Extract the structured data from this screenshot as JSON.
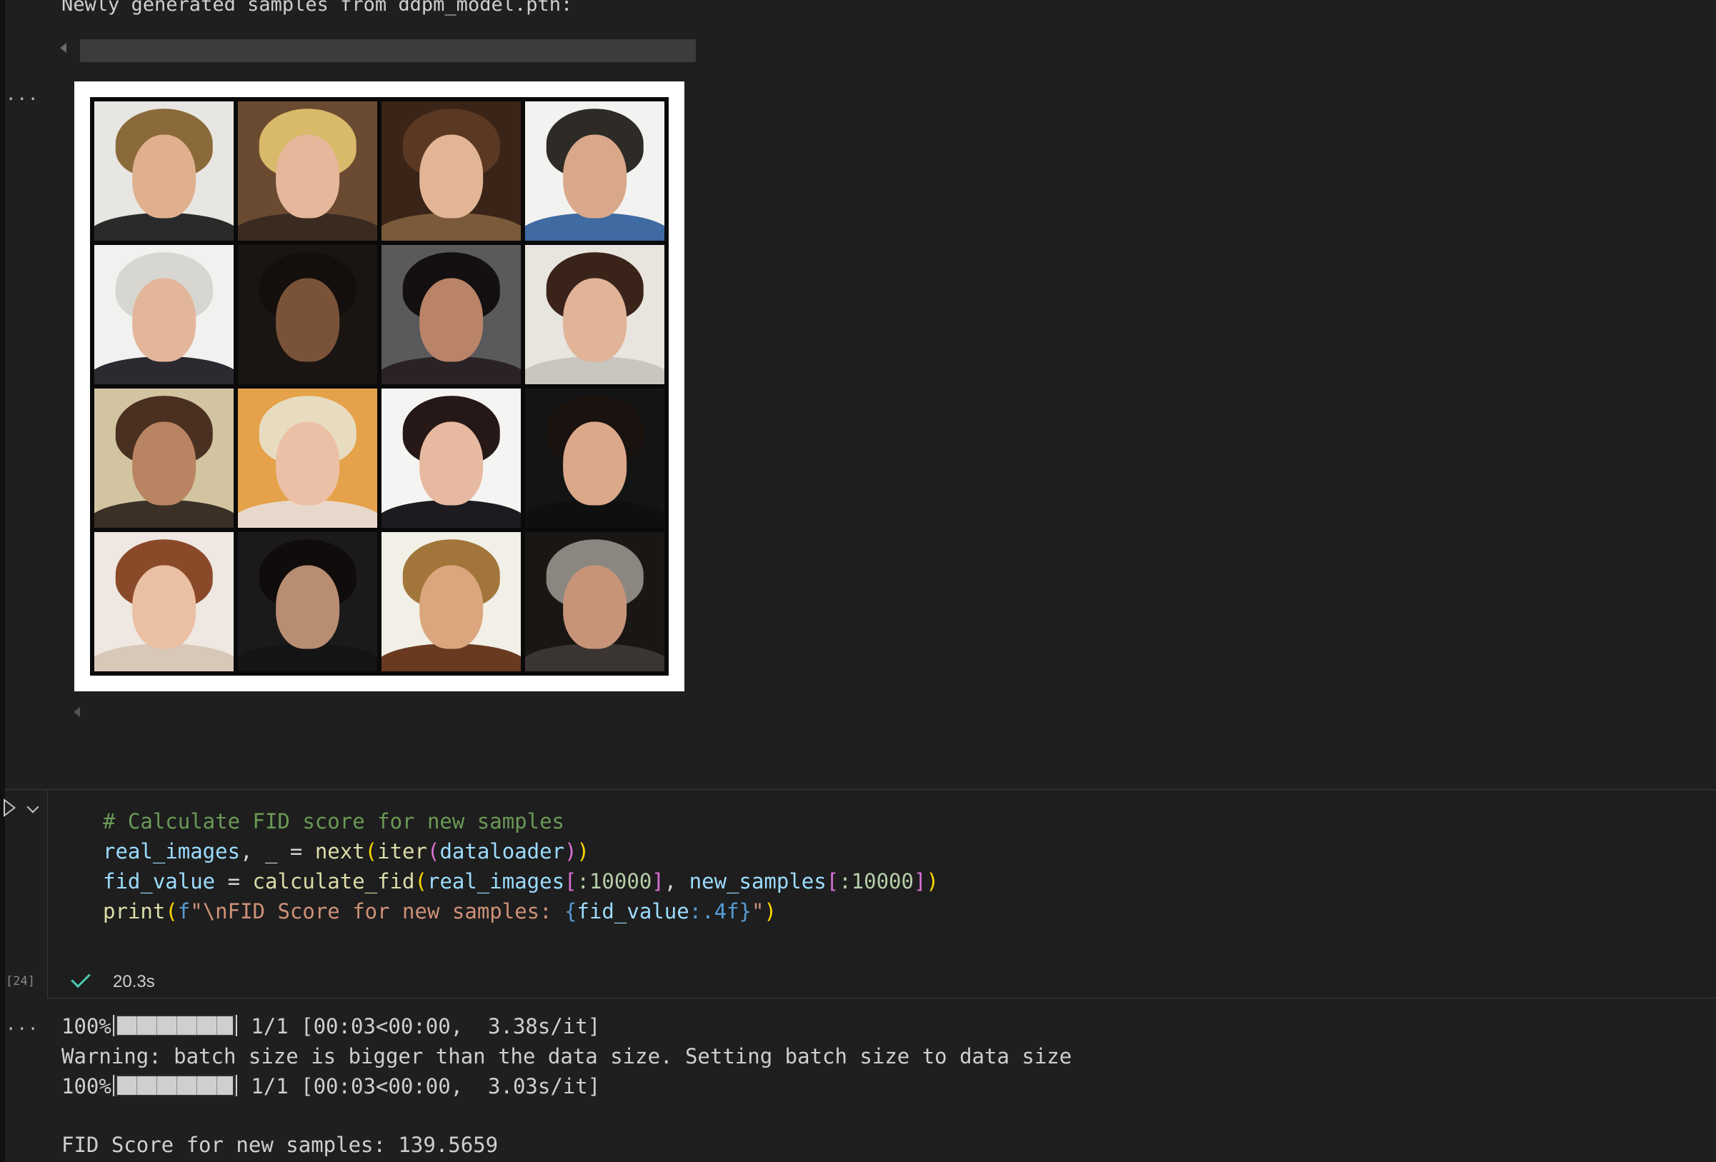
{
  "output_top": {
    "heading": "Newly generated samples from ddpm_model.pth:",
    "image_grid": {
      "rows": 4,
      "cols": 4,
      "tiles": [
        {
          "bg": "#e8e6e2",
          "hair": "#8a6a3a",
          "skin": "#e0b08e",
          "cloth": "#2a2a2a"
        },
        {
          "bg": "#6b4a32",
          "hair": "#d9b96a",
          "skin": "#e6b79a",
          "cloth": "#3a2a20"
        },
        {
          "bg": "#3a2418",
          "hair": "#5a3822",
          "skin": "#e2b594",
          "cloth": "#7a5a3a"
        },
        {
          "bg": "#f2f2f0",
          "hair": "#2e2a26",
          "skin": "#d9a88a",
          "cloth": "#3f6aa2"
        },
        {
          "bg": "#f1f1ef",
          "hair": "#d8d6d0",
          "skin": "#e3b69b",
          "cloth": "#2a2a30"
        },
        {
          "bg": "#1a1512",
          "hair": "#140f0c",
          "skin": "#7a5238",
          "cloth": "#1a1512"
        },
        {
          "bg": "#5a5a5c",
          "hair": "#141011",
          "skin": "#b98468",
          "cloth": "#2a2224"
        },
        {
          "bg": "#e8e4de",
          "hair": "#3a241a",
          "skin": "#e1b397",
          "cloth": "#c9c5bf"
        },
        {
          "bg": "#d2c4a0",
          "hair": "#4a3020",
          "skin": "#b98462",
          "cloth": "#3a3026"
        },
        {
          "bg": "#e5a24a",
          "hair": "#e8dcc0",
          "skin": "#ecc0a6",
          "cloth": "#e8d8cc"
        },
        {
          "bg": "#f4f4f2",
          "hair": "#261816",
          "skin": "#e7b9a0",
          "cloth": "#1d1b20"
        },
        {
          "bg": "#141414",
          "hair": "#1a120e",
          "skin": "#dba98a",
          "cloth": "#0f0f10"
        },
        {
          "bg": "#efe8e2",
          "hair": "#8a4a2a",
          "skin": "#ebbfa4",
          "cloth": "#d8c8b8"
        },
        {
          "bg": "#1b1a1a",
          "hair": "#100c0b",
          "skin": "#b88d72",
          "cloth": "#151415"
        },
        {
          "bg": "#f1efe6",
          "hair": "#a2763a",
          "skin": "#dba67e",
          "cloth": "#6a3a20"
        },
        {
          "bg": "#1a1614",
          "hair": "#8c8680",
          "skin": "#c79478",
          "cloth": "#3a3432"
        }
      ]
    }
  },
  "left_gutter": {
    "ellipsis_1": "...",
    "ellipsis_2": "...",
    "execution_count": "[24]"
  },
  "code_cell": {
    "tokens": {
      "l1_comment": "# Calculate FID score for new samples",
      "l2_real_images": "real_images",
      "l2_sep": ", _ = ",
      "l2_next": "next",
      "l2_paren_open": "(",
      "l2_iter": "iter",
      "l2_paren2_open": "(",
      "l2_dataloader": "dataloader",
      "l2_paren2_close": ")",
      "l2_paren_close": ")",
      "l3_fid_value": "fid_value",
      "l3_eq": " = ",
      "l3_calc": "calculate_fid",
      "l3_paren_open": "(",
      "l3_real_images": "real_images",
      "l3_br_open": "[",
      "l3_slice1": ":10000",
      "l3_br_close": "]",
      "l3_comma": ", ",
      "l3_new_samples": "new_samples",
      "l3_br2_open": "[",
      "l3_slice2": ":10000",
      "l3_br2_close": "]",
      "l3_paren_close": ")",
      "l4_print": "print",
      "l4_paren_open": "(",
      "l4_fprefix": "f",
      "l4_str1": "\"\\nFID Score for new samples: ",
      "l4_brace_open": "{",
      "l4_fid_value": "fid_value",
      "l4_fmt": ":.4f",
      "l4_brace_close": "}",
      "l4_str2": "\"",
      "l4_paren_close": ")"
    },
    "status": {
      "duration": "20.3s"
    }
  },
  "output_bottom": {
    "line1": {
      "pct": "100%",
      "progress": 1.0,
      "rest": " 1/1 [00:03<00:00,  3.38s/it]"
    },
    "line2": "Warning: batch size is bigger than the data size. Setting batch size to data size",
    "line3": {
      "pct": "100%",
      "progress": 1.0,
      "rest": " 1/1 [00:03<00:00,  3.03s/it]"
    },
    "line4": "FID Score for new samples: 139.5659"
  }
}
